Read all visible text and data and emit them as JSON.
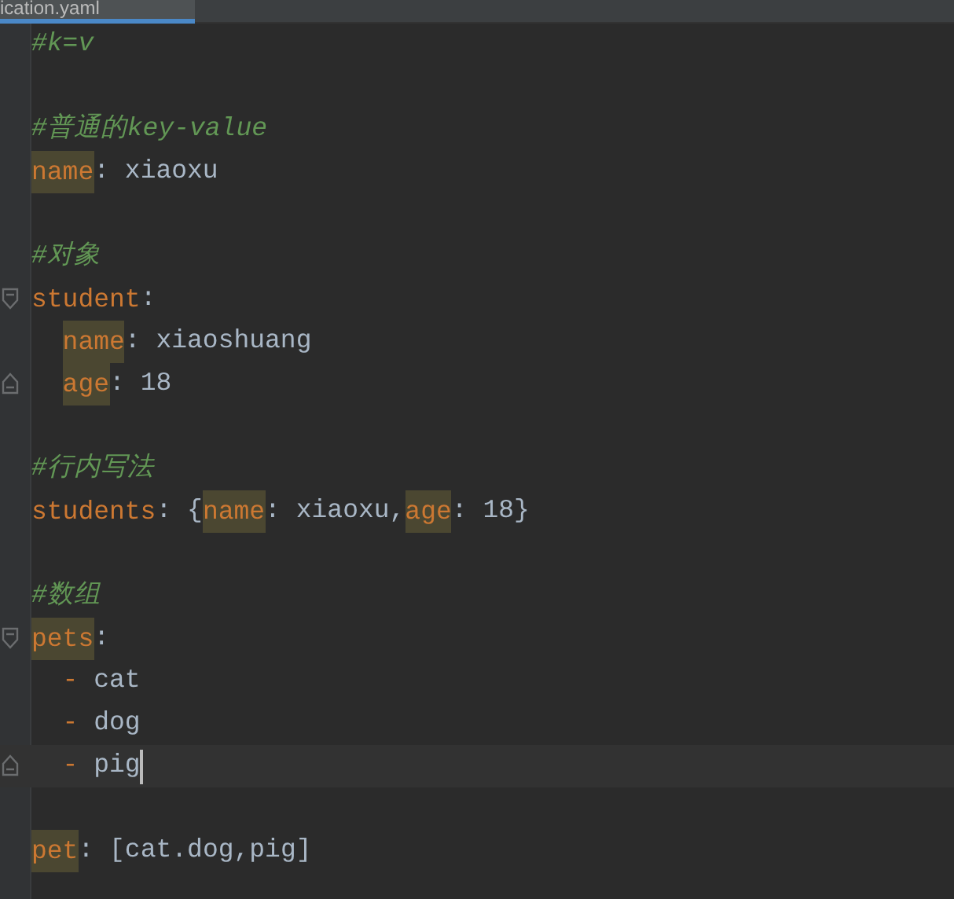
{
  "tab": {
    "title": "ication.yaml",
    "selected": true
  },
  "lines": [
    {
      "kind": "code",
      "tokens": [
        {
          "kind": "comment",
          "text": "#k=v"
        }
      ]
    },
    {
      "kind": "blank"
    },
    {
      "kind": "code",
      "tokens": [
        {
          "kind": "comment",
          "text": "#普通的key-value"
        }
      ]
    },
    {
      "kind": "code",
      "tokens": [
        {
          "kind": "key",
          "text": "name",
          "highlighted": true
        },
        {
          "kind": "punct",
          "text": ":"
        },
        {
          "kind": "value",
          "text": "xiaoxu"
        }
      ]
    },
    {
      "kind": "blank"
    },
    {
      "kind": "code",
      "tokens": [
        {
          "kind": "comment",
          "text": "#对象"
        }
      ]
    },
    {
      "kind": "code",
      "expanded": true,
      "tokens": [
        {
          "kind": "key",
          "text": "student",
          "highlighted": false
        },
        {
          "kind": "punct",
          "text": ":"
        }
      ],
      "children": [
        {
          "kind": "code",
          "tokens": [
            {
              "kind": "key",
              "text": "name",
              "highlighted": true
            },
            {
              "kind": "punct",
              "text": ":"
            },
            {
              "kind": "value",
              "text": "xiaoshuang"
            }
          ]
        },
        {
          "kind": "code",
          "tokens": [
            {
              "kind": "key",
              "text": "age",
              "highlighted": true
            },
            {
              "kind": "punct",
              "text": ":"
            },
            {
              "kind": "value",
              "text": "18"
            }
          ]
        }
      ]
    },
    {
      "kind": "blank"
    },
    {
      "kind": "code",
      "tokens": [
        {
          "kind": "comment",
          "text": "#行内写法"
        }
      ]
    },
    {
      "kind": "code",
      "tokens": [
        {
          "kind": "key",
          "text": "students",
          "highlighted": false
        },
        {
          "kind": "punct",
          "text": ":"
        },
        {
          "kind": "punct",
          "text": "{"
        },
        {
          "kind": "key",
          "text": "name",
          "highlighted": true
        },
        {
          "kind": "punct",
          "text": ":"
        },
        {
          "kind": "value",
          "text": "xiaoxu,"
        },
        {
          "kind": "key",
          "text": "age",
          "highlighted": true
        },
        {
          "kind": "punct",
          "text": ":"
        },
        {
          "kind": "value",
          "text": "18}"
        }
      ]
    },
    {
      "kind": "blank"
    },
    {
      "kind": "code",
      "tokens": [
        {
          "kind": "comment",
          "text": "#数组"
        }
      ]
    },
    {
      "kind": "code",
      "expanded": true,
      "tokens": [
        {
          "kind": "key",
          "text": "pets",
          "highlighted": true
        },
        {
          "kind": "punct",
          "text": ":"
        }
      ],
      "children": [
        {
          "kind": "code",
          "tokens": [
            {
              "kind": "punct",
              "text": "-"
            },
            {
              "kind": "value",
              "text": "cat"
            }
          ]
        },
        {
          "kind": "code",
          "tokens": [
            {
              "kind": "punct",
              "text": "-"
            },
            {
              "kind": "value",
              "text": "dog"
            }
          ]
        },
        {
          "kind": "code",
          "current": true,
          "caret": true,
          "tokens": [
            {
              "kind": "punct",
              "text": "-"
            },
            {
              "kind": "value",
              "text": "pig"
            }
          ]
        }
      ]
    },
    {
      "kind": "blank"
    },
    {
      "kind": "code",
      "tokens": [
        {
          "kind": "key",
          "text": "pet",
          "highlighted": true
        },
        {
          "kind": "punct",
          "text": ":"
        },
        {
          "kind": "value",
          "text": "[cat.dog,pig]"
        }
      ]
    }
  ]
}
